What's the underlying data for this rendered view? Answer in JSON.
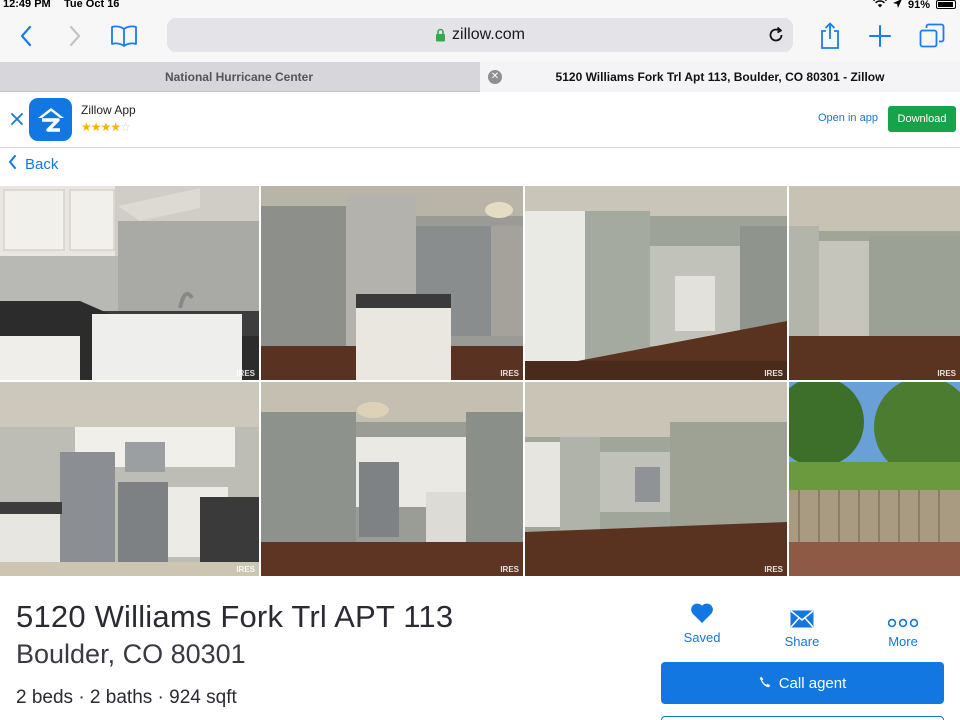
{
  "status_bar": {
    "time": "12:49 PM",
    "date": "Tue Oct 16",
    "battery": "91%",
    "battery_level": 0.91
  },
  "browser": {
    "url": "zillow.com",
    "tabs": [
      {
        "label": "National Hurricane Center",
        "active": false
      },
      {
        "label": "5120 Williams Fork Trl Apt 113, Boulder, CO 80301 - Zillow",
        "active": true
      }
    ],
    "accent_color": "#1a7cf5"
  },
  "app_banner": {
    "app_name": "Zillow App",
    "rating": 4,
    "open_label": "Open in app",
    "download_label": "Download"
  },
  "nav": {
    "back_label": "Back"
  },
  "photos": {
    "watermark": "IRES",
    "items": [
      {
        "subject": "kitchen-sink"
      },
      {
        "subject": "kitchen-island"
      },
      {
        "subject": "entry-hallway"
      },
      {
        "subject": "living-room"
      },
      {
        "subject": "kitchen-appliances"
      },
      {
        "subject": "kitchen-from-living"
      },
      {
        "subject": "living-room-wide"
      },
      {
        "subject": "patio"
      }
    ]
  },
  "listing": {
    "address_line1": "5120 Williams Fork Trl APT 113",
    "address_line2": "Boulder, CO 80301",
    "facts": "2 beds · 2 baths · 924 sqft"
  },
  "actions": {
    "saved_label": "Saved",
    "share_label": "Share",
    "more_label": "More",
    "call_label": "Call agent"
  },
  "colors": {
    "zillow_blue": "#1277e1",
    "download_green": "#16a34a",
    "text_dark": "#2a2a33"
  }
}
